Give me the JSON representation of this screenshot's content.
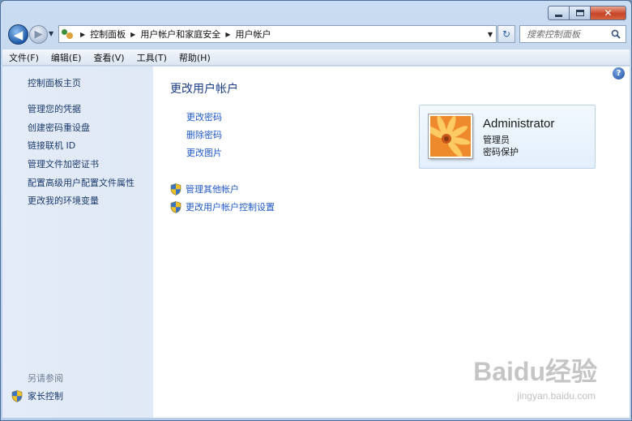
{
  "window": {
    "caption_min_icon": "minimize-icon",
    "caption_max_icon": "maximize-icon",
    "caption_close_glyph": "✕"
  },
  "navigation": {
    "back_glyph": "◀",
    "forward_glyph": "▶",
    "breadcrumbs": [
      "控制面板",
      "用户帐户和家庭安全",
      "用户帐户"
    ],
    "search_placeholder": "搜索控制面板",
    "refresh_glyph": "↻"
  },
  "menu": {
    "items": [
      "文件(F)",
      "编辑(E)",
      "查看(V)",
      "工具(T)",
      "帮助(H)"
    ]
  },
  "sidebar": {
    "home_link": "控制面板主页",
    "links": [
      "管理您的凭据",
      "创建密码重设盘",
      "链接联机 ID",
      "管理文件加密证书",
      "配置高级用户配置文件属性",
      "更改我的环境变量"
    ],
    "see_also_heading": "另请参阅",
    "see_also_link": "家长控制"
  },
  "main": {
    "title": "更改用户帐户",
    "tasks": [
      "更改密码",
      "删除密码",
      "更改图片"
    ],
    "shield_tasks": [
      "管理其他帐户",
      "更改用户帐户控制设置"
    ],
    "help_glyph": "?"
  },
  "account": {
    "name": "Administrator",
    "role": "管理员",
    "status": "密码保护"
  },
  "watermark": {
    "brand": "Baidu经验",
    "url": "jingyan.baidu.com"
  },
  "colors": {
    "link": "#1f58c6",
    "title": "#1b3e86",
    "sidebar_link": "#1c3b6e",
    "close_button": "#c7452a"
  }
}
